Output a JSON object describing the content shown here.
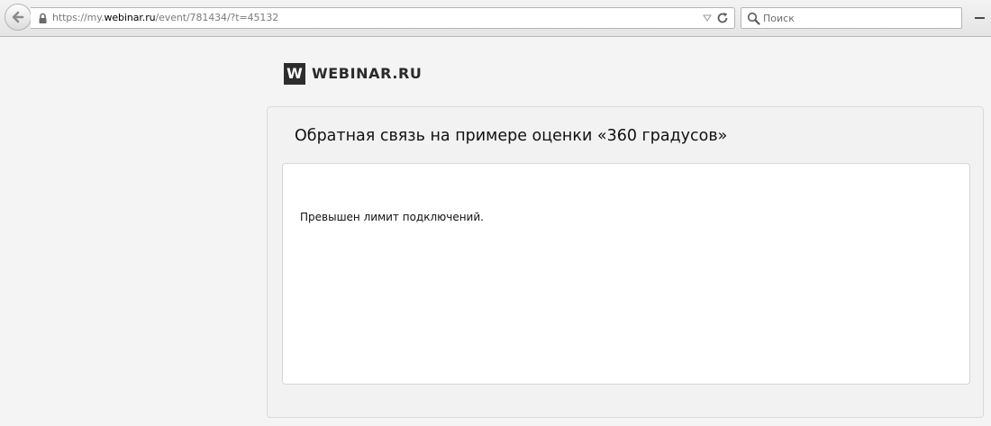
{
  "browser": {
    "url_scheme": "https://my.",
    "url_host": "webinar.ru",
    "url_path": "/event/781434/?t=45132",
    "search_placeholder": "Поиск"
  },
  "page": {
    "logo_mark": "W",
    "logo_text": "WEBINAR.RU",
    "event_title": "Обратная связь на примере оценки «360 градусов»",
    "message": "Превышен лимит подключений."
  },
  "icons": {
    "back": "back-arrow-icon",
    "lock": "lock-icon",
    "dropdown": "dropdown-triangle-icon",
    "reload": "reload-icon",
    "search": "magnifier-icon"
  }
}
